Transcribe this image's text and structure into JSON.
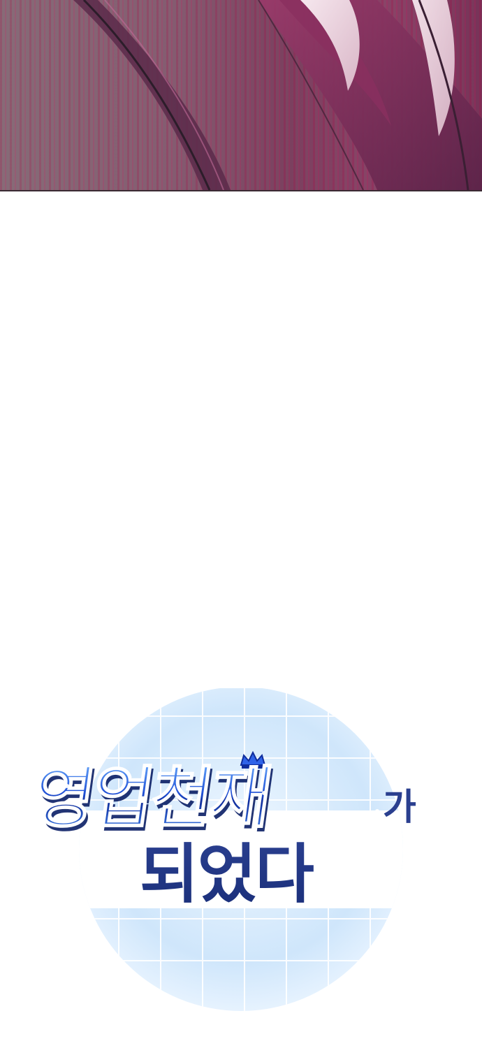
{
  "title": {
    "line1_main": "영업천재",
    "line1_suffix": "가",
    "line2": "되었다"
  },
  "colors": {
    "panel_base": "#8a5d74",
    "panel_accent": "#7e3a5e",
    "title_blue": "#1f4fd6",
    "title_dark": "#1a2f7a",
    "badge_light": "#dcefff"
  },
  "icons": {
    "crown": "crown-icon"
  }
}
